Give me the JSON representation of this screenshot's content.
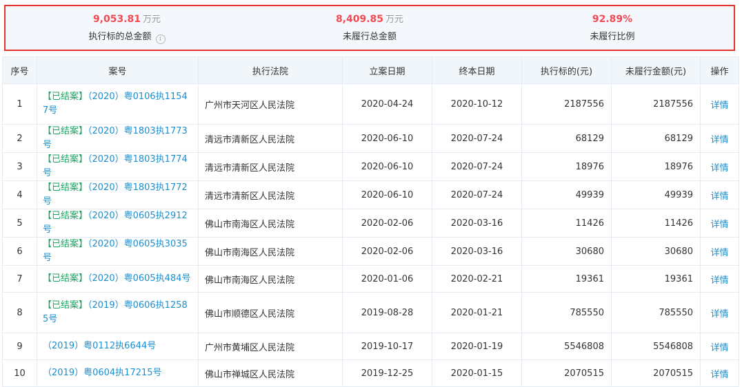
{
  "summary": {
    "total": {
      "value": "9,053.81",
      "unit": "万元",
      "label": "执行标的总金额"
    },
    "unfulfilled": {
      "value": "8,409.85",
      "unit": "万元",
      "label": "未履行总金额"
    },
    "ratio": {
      "value": "92.89%",
      "label": "未履行比例"
    }
  },
  "table": {
    "headers": [
      "序号",
      "案号",
      "执行法院",
      "立案日期",
      "终本日期",
      "执行标的(元)",
      "未履行金额(元)",
      "操作"
    ],
    "rows": [
      {
        "no": "1",
        "tag": "【已结案】",
        "case": "（2020）粤0106执11547号",
        "court": "广州市天河区人民法院",
        "filed": "2020-04-24",
        "closed": "2020-10-12",
        "target": "2187556",
        "unpaid": "2187556",
        "action": "详情"
      },
      {
        "no": "2",
        "tag": "【已结案】",
        "case": "（2020）粤1803执1773号",
        "court": "清远市清新区人民法院",
        "filed": "2020-06-10",
        "closed": "2020-07-24",
        "target": "68129",
        "unpaid": "68129",
        "action": "详情"
      },
      {
        "no": "3",
        "tag": "【已结案】",
        "case": "（2020）粤1803执1774号",
        "court": "清远市清新区人民法院",
        "filed": "2020-06-10",
        "closed": "2020-07-24",
        "target": "18976",
        "unpaid": "18976",
        "action": "详情"
      },
      {
        "no": "4",
        "tag": "【已结案】",
        "case": "（2020）粤1803执1772号",
        "court": "清远市清新区人民法院",
        "filed": "2020-06-10",
        "closed": "2020-07-24",
        "target": "49939",
        "unpaid": "49939",
        "action": "详情"
      },
      {
        "no": "5",
        "tag": "【已结案】",
        "case": "（2020）粤0605执2912号",
        "court": "佛山市南海区人民法院",
        "filed": "2020-02-06",
        "closed": "2020-03-16",
        "target": "11426",
        "unpaid": "11426",
        "action": "详情"
      },
      {
        "no": "6",
        "tag": "【已结案】",
        "case": "（2020）粤0605执3035号",
        "court": "佛山市南海区人民法院",
        "filed": "2020-02-06",
        "closed": "2020-03-16",
        "target": "30680",
        "unpaid": "30680",
        "action": "详情"
      },
      {
        "no": "7",
        "tag": "【已结案】",
        "case": "（2020）粤0605执484号",
        "court": "佛山市南海区人民法院",
        "filed": "2020-01-06",
        "closed": "2020-02-21",
        "target": "19361",
        "unpaid": "19361",
        "action": "详情"
      },
      {
        "no": "8",
        "tag": "【已结案】",
        "case": "（2019）粤0606执12585号",
        "court": "佛山市顺德区人民法院",
        "filed": "2019-08-28",
        "closed": "2020-01-21",
        "target": "785550",
        "unpaid": "785550",
        "action": "详情"
      },
      {
        "no": "9",
        "tag": "",
        "case": "（2019）粤0112执6644号",
        "court": "广州市黄埔区人民法院",
        "filed": "2019-10-17",
        "closed": "2020-01-19",
        "target": "5546808",
        "unpaid": "5546808",
        "action": "详情"
      },
      {
        "no": "10",
        "tag": "",
        "case": "（2019）粤0604执17215号",
        "court": "佛山市禅城区人民法院",
        "filed": "2019-12-25",
        "closed": "2020-01-15",
        "target": "2070515",
        "unpaid": "2070515",
        "action": "详情"
      }
    ]
  },
  "colors": {
    "highlight_border": "#e5322b",
    "amount": "#f04a52",
    "link": "#1a8fcf",
    "closed_tag": "#1aa260"
  }
}
